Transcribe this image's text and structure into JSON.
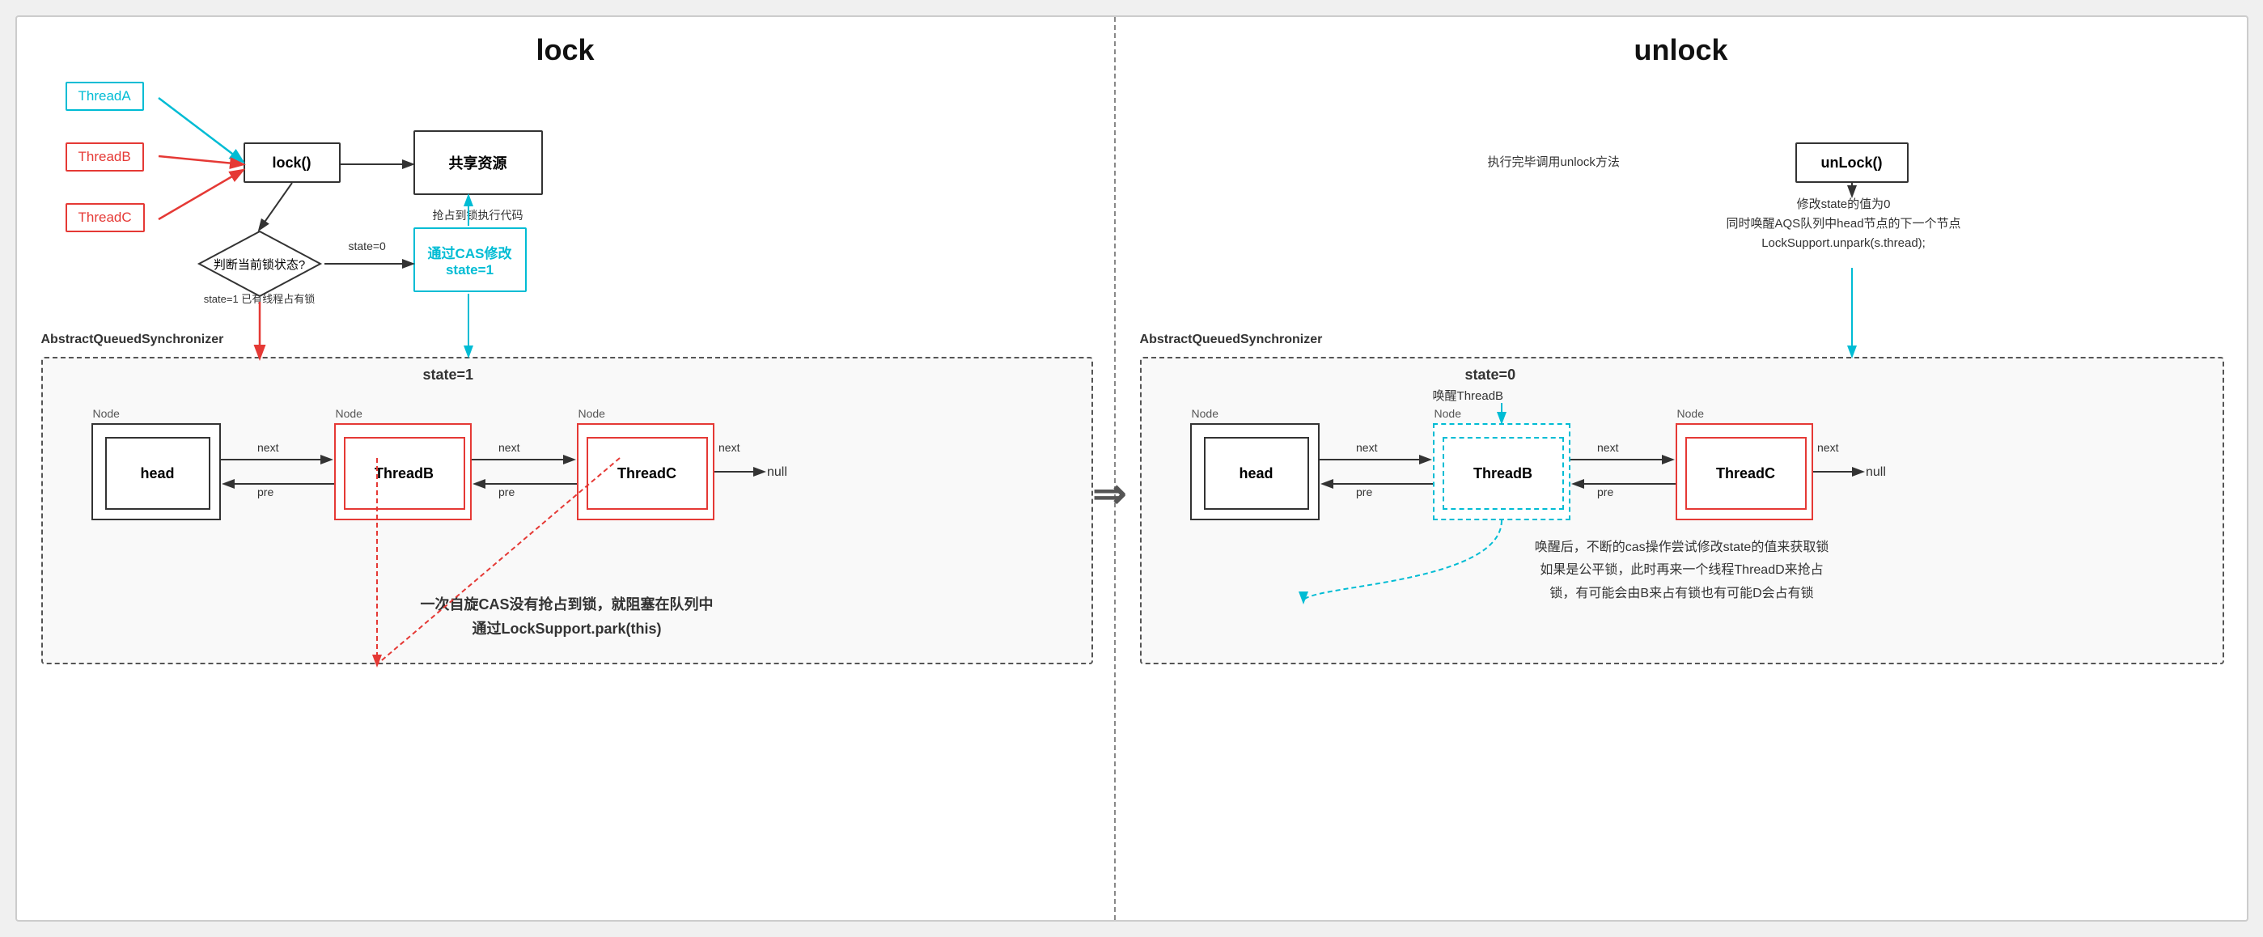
{
  "lock_panel": {
    "title": "lock",
    "threads": [
      {
        "id": "threadA",
        "label": "ThreadA",
        "color": "cyan"
      },
      {
        "id": "threadB",
        "label": "ThreadB",
        "color": "red"
      },
      {
        "id": "threadC",
        "label": "ThreadC",
        "color": "red"
      }
    ],
    "lock_box": "lock()",
    "shared_resource": "共享资源",
    "diamond_text": "判断当前锁状态?",
    "cas_box_line1": "通过CAS修改",
    "cas_box_line2": "state=1",
    "state0_label": "state=0",
    "state1_label": "state=1\n已有线程占有锁",
    "aqs_title": "AbstractQueuedSynchronizer",
    "aqs_state": "state=1",
    "shared_label": "抢占到锁执行代码",
    "bottom_text1": "一次自旋CAS没有抢占到锁，就阻塞在队列中",
    "bottom_text2": "通过LockSupport.park(this)",
    "nodes": [
      {
        "label": "Node",
        "inner": "head"
      },
      {
        "label": "Node",
        "inner": "ThreadB",
        "red": true
      },
      {
        "label": "Node",
        "inner": "ThreadC",
        "red": true
      }
    ],
    "next_labels": [
      "next",
      "next",
      "next"
    ],
    "pre_labels": [
      "pre",
      "pre"
    ],
    "null_label": "null"
  },
  "unlock_panel": {
    "title": "unlock",
    "unlock_box": "unLock()",
    "unlock_label": "执行完毕调用unlock方法",
    "modify_text1": "修改state的值为0",
    "modify_text2": "同时唤醒AQS队列中head节点的下一个节点",
    "modify_text3": "LockSupport.unpark(s.thread);",
    "aqs_title": "AbstractQueuedSynchronizer",
    "aqs_state": "state=0",
    "wakeup_label": "唤醒ThreadB",
    "bottom_text1": "唤醒后，不断的cas操作尝试修改state的值来获取锁",
    "bottom_text2": "如果是公平锁，此时再来一个线程ThreadD来抢占",
    "bottom_text3": "锁，有可能会由B来占有锁也有可能D会占有锁",
    "nodes": [
      {
        "label": "Node",
        "inner": "head"
      },
      {
        "label": "Node",
        "inner": "ThreadB",
        "cyan_dashed": true
      },
      {
        "label": "Node",
        "inner": "ThreadC",
        "red": true
      }
    ],
    "next_labels": [
      "next",
      "next",
      "next"
    ],
    "pre_labels": [
      "pre",
      "pre"
    ],
    "null_label": "null"
  }
}
